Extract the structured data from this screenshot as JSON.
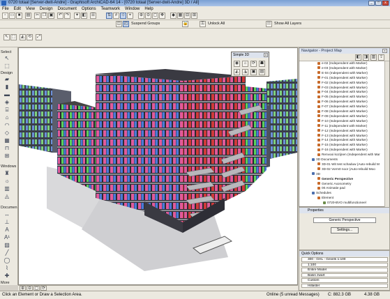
{
  "window": {
    "title": "0720 totaal [Server-dwit-Andre] - Graphisoft ArchiCAD-64 14 - [0720 totaal [Server-dwit-Andre] 3D / All]"
  },
  "menu": [
    "File",
    "Edit",
    "View",
    "Design",
    "Document",
    "Options",
    "Teamwork",
    "Window",
    "Help"
  ],
  "toolbar2": {
    "suspend_groups": "Suspend Groups",
    "unlock_all": "Unlock All",
    "show_all_layers": "Show All Layers"
  },
  "toolbox": {
    "select": "Select",
    "design": "Design",
    "windows": "Windows",
    "document": "Documen",
    "more": "More"
  },
  "simple3d": {
    "title": "Simple 3D"
  },
  "navigator": {
    "title": "Navigator - Project Map",
    "rows": [
      {
        "label": "e-02 (Independent with Marker)",
        "level": 2
      },
      {
        "label": "e-03 (Independent with Marker)",
        "level": 2
      },
      {
        "label": "E-04 (Independent with Marker)",
        "level": 2
      },
      {
        "label": "F-01 (Independent with Marker)",
        "level": 2
      },
      {
        "label": "F-02 (Independent with Marker)",
        "level": 2
      },
      {
        "label": "F-03 (Independent with Marker)",
        "level": 2
      },
      {
        "label": "F-04 (Independent with Marker)",
        "level": 2
      },
      {
        "label": "F-05 (Independent with Marker)",
        "level": 2
      },
      {
        "label": "F-06 (Independent with Marker)",
        "level": 2
      },
      {
        "label": "F-07 (Independent with Marker)",
        "level": 2
      },
      {
        "label": "F-08 (Independent with Marker)",
        "level": 2
      },
      {
        "label": "F-09 (Independent with Marker)",
        "level": 2
      },
      {
        "label": "F-10 (Independent with Marker)",
        "level": 2
      },
      {
        "label": "F-11 (Independent with Marker)",
        "level": 2
      },
      {
        "label": "F-12 (Independent with Marker)",
        "level": 2
      },
      {
        "label": "F-13 (Independent with Marker)",
        "level": 2
      },
      {
        "label": "F-14 (Independent with Marker)",
        "level": 2
      },
      {
        "label": "F-15 (Independent with Marker)",
        "level": 2
      },
      {
        "label": "F-16 (Independent with Marker)",
        "level": 2
      },
      {
        "label": "Renvooi kozijnen (Independent with Mar",
        "level": 2
      },
      {
        "label": "3D Documents",
        "level": 1
      },
      {
        "label": "3D-01 Wit test schaduw (Auto-rebuild M",
        "level": 2
      },
      {
        "label": "3D-02 Vorm0 noor (Auto-rebuild Moo",
        "level": 2
      },
      {
        "label": "3D",
        "level": 1
      },
      {
        "label": "Generic Perspective",
        "level": 2,
        "bold": true
      },
      {
        "label": "Generic Axonometry",
        "level": 2
      },
      {
        "label": "00 Animatie pad",
        "level": 2
      },
      {
        "label": "Schedules",
        "level": 1
      },
      {
        "label": "Element",
        "level": 2
      },
      {
        "label": "0720-BVO multifunctioneel",
        "level": 3
      }
    ]
  },
  "properties": {
    "title": "Properties",
    "view_name": "Generic Perspective",
    "settings_label": "Settings..."
  },
  "quick_options": {
    "title": "Quick Options",
    "rows": [
      "300 - GHL - Gevels 1:100",
      "1:100",
      "Entire Model",
      "Basis zwart",
      "Custom",
      "Hillaster"
    ]
  },
  "status": {
    "message": "Click an Element or Draw a Selection Area.",
    "online": "Online (5 unread Messages)",
    "disk_c": "C: 882.3 GB",
    "ram": "4.38 GB"
  },
  "colors": {
    "building_glass_pink": "#e05a9a",
    "building_glass_blue": "#4a7ad8",
    "building_glass_green": "#5ad05a",
    "building_glass_red": "#d03a3a",
    "facade_dark": "#2a2a30"
  }
}
